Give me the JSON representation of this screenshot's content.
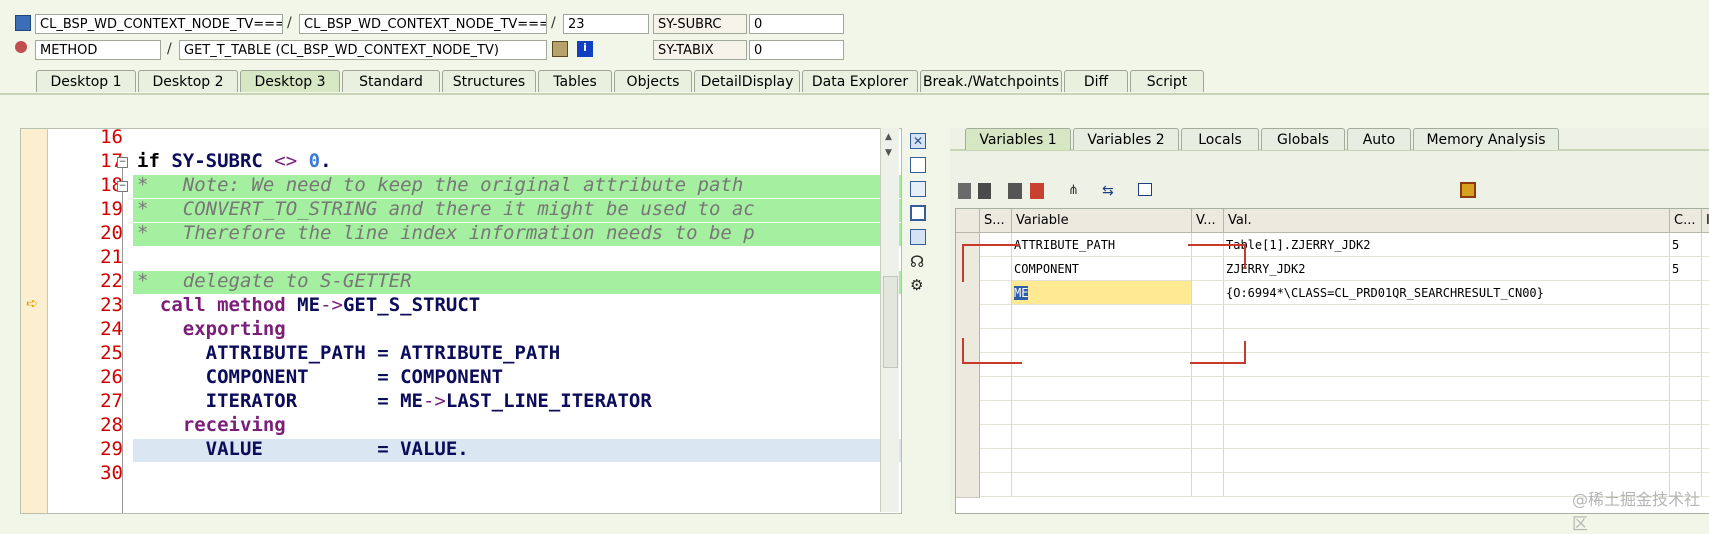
{
  "header": {
    "program_field": "CL_BSP_WD_CONTEXT_NODE_TV====...",
    "include_field": "CL_BSP_WD_CONTEXT_NODE_TV====...",
    "line_field": "23",
    "subrc_label": "SY-SUBRC",
    "subrc_value": "0",
    "event_type": "METHOD",
    "event_name": "GET_T_TABLE (CL_BSP_WD_CONTEXT_NODE_TV)",
    "tabix_label": "SY-TABIX",
    "tabix_value": "0",
    "slash": "/"
  },
  "main_tabs": [
    "Desktop 1",
    "Desktop 2",
    "Desktop 3",
    "Standard",
    "Structures",
    "Tables",
    "Objects",
    "DetailDisplay",
    "Data Explorer",
    "Break./Watchpoints",
    "Diff",
    "Script"
  ],
  "active_main_tab": "Desktop 3",
  "code_lines": [
    {
      "n": "16",
      "text": ""
    },
    {
      "n": "17",
      "text": "if SY-SUBRC <> 0."
    },
    {
      "n": "18",
      "text": "*   Note: We need to keep the original attribute path"
    },
    {
      "n": "19",
      "text": "*   CONVERT_TO_STRING and there it might be used to ac"
    },
    {
      "n": "20",
      "text": "*   Therefore the line index information needs to be p"
    },
    {
      "n": "21",
      "text": ""
    },
    {
      "n": "22",
      "text": "*   delegate to S-GETTER"
    },
    {
      "n": "23",
      "text": "  call method ME->GET_S_STRUCT"
    },
    {
      "n": "24",
      "text": "    exporting"
    },
    {
      "n": "25",
      "text": "      ATTRIBUTE_PATH = ATTRIBUTE_PATH"
    },
    {
      "n": "26",
      "text": "      COMPONENT      = COMPONENT"
    },
    {
      "n": "27",
      "text": "      ITERATOR       = ME->LAST_LINE_ITERATOR"
    },
    {
      "n": "28",
      "text": "    receiving"
    },
    {
      "n": "29",
      "text": "      VALUE          = VALUE."
    },
    {
      "n": "30",
      "text": ""
    }
  ],
  "var_tabs": [
    "Variables 1",
    "Variables 2",
    "Locals",
    "Globals",
    "Auto",
    "Memory Analysis"
  ],
  "active_var_tab": "Variables 1",
  "grid": {
    "headers": [
      "S...",
      "Variable",
      "V...",
      "Val.",
      "C...",
      "I"
    ],
    "rows": [
      {
        "variable": "ATTRIBUTE_PATH",
        "value": "Table[1].ZJERRY_JDK2",
        "c": "5"
      },
      {
        "variable": "COMPONENT",
        "value": "ZJERRY_JDK2",
        "c": "5"
      },
      {
        "variable": "ME",
        "value": "{O:6994*\\CLASS=CL_PRD01QR_SEARCHRESULT_CN00}",
        "c": ""
      }
    ]
  },
  "watermark": "@稀土掘金技术社区",
  "colors": {
    "accent_green": "#a5f0a0",
    "line_number": "#d40000",
    "selection": "#2f5ea8",
    "annotation": "#c83a2a"
  }
}
